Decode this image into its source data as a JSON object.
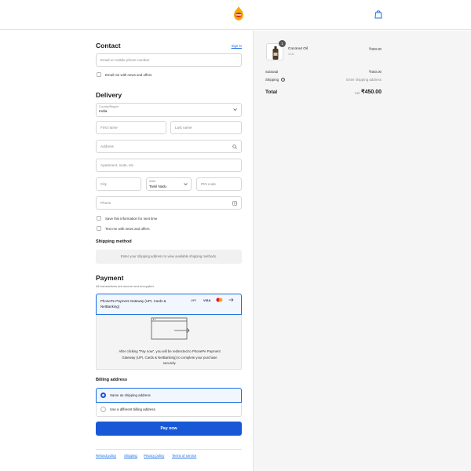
{
  "header": {
    "logo_icon": "brand-logo-icon",
    "cart_icon": "shopping-bag-icon"
  },
  "contact": {
    "title": "Contact",
    "signin": "Sign in",
    "email_placeholder": "Email or mobile phone number",
    "news_label": "Email me with news and offers"
  },
  "delivery": {
    "title": "Delivery",
    "country_label": "Country/Region",
    "country_value": "India",
    "first_name": "First name",
    "last_name": "Last name",
    "address": "Address",
    "apartment": "Apartment, suite, etc.",
    "city": "City",
    "state_label": "State",
    "state_value": "Tamil Nadu",
    "pin": "PIN code",
    "phone": "Phone",
    "save_info": "Save this information for next time",
    "text_news": "Text me with news and offers"
  },
  "shipping": {
    "title": "Shipping method",
    "notice": "Enter your shipping address to view available shipping methods."
  },
  "payment": {
    "title": "Payment",
    "subtitle": "All transactions are secure and encrypted.",
    "gateway_name": "PhonePe Payment Gateway (UPI, Cards & NetBanking)",
    "badges": [
      "UPI",
      "VISA"
    ],
    "info_text": "After clicking “Pay now”, you will be redirected to PhonePe Payment Gateway (UPI, Cards & NetBanking) to complete your purchase securely."
  },
  "billing": {
    "title": "Billing address",
    "option_same": "Same as shipping address",
    "option_diff": "Use a different billing address"
  },
  "pay_button": "Pay now",
  "footer": {
    "links": [
      "Refund policy",
      "Shipping",
      "Privacy policy",
      "Terms of service"
    ]
  },
  "summary": {
    "item_name": "Coconut Oil",
    "item_variant": "1 Ltr",
    "item_qty": "1",
    "item_price": "₹450.00",
    "subtotal_label": "Subtotal",
    "subtotal_value": "₹450.00",
    "shipping_label": "Shipping",
    "shipping_value": "Enter shipping address",
    "total_label": "Total",
    "currency": "INR",
    "total_value": "₹450.00"
  },
  "colors": {
    "accent": "#1858d6",
    "link": "#1a6fe0",
    "panel": "#f5f5f5"
  }
}
